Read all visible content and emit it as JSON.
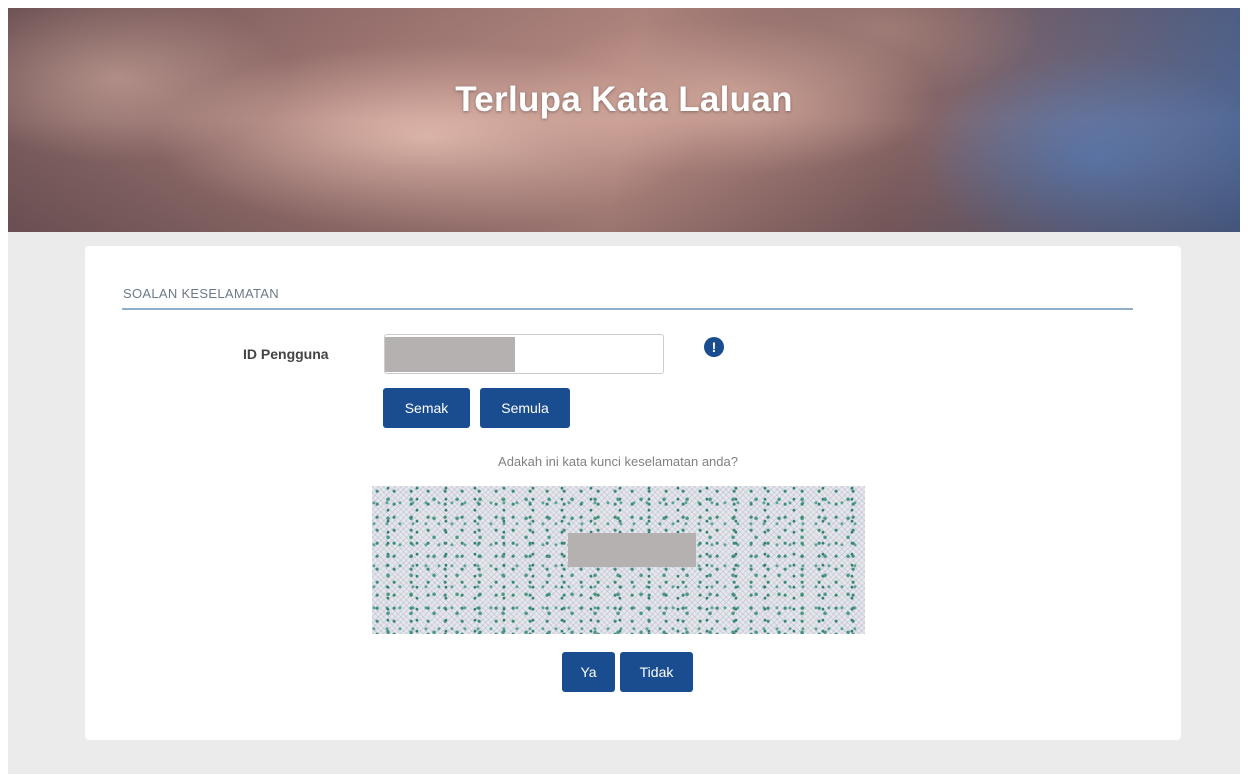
{
  "hero": {
    "title": "Terlupa Kata Laluan"
  },
  "form": {
    "section_title": "SOALAN KESELAMATAN",
    "user_id": {
      "label": "ID Pengguna",
      "value": ""
    },
    "buttons": {
      "check": "Semak",
      "reset": "Semula"
    },
    "info_icon": "info-icon",
    "keyword_prompt": "Adakah ini kata kunci keselamatan anda?",
    "confirm_buttons": {
      "yes": "Ya",
      "no": "Tidak"
    }
  },
  "colors": {
    "primary_button": "#1a4d8f",
    "page_background": "#ecebec",
    "section_rule": "#8fb0c8"
  }
}
